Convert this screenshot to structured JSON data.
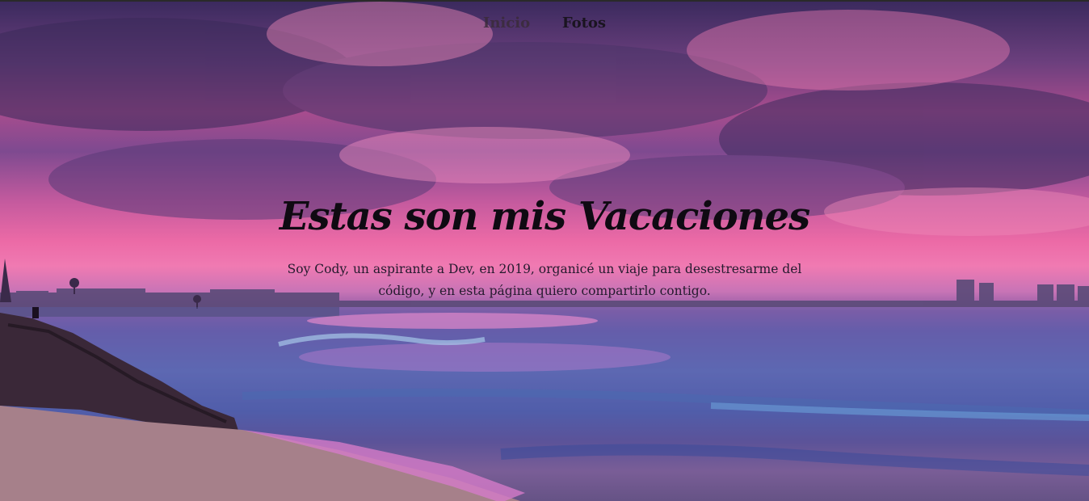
{
  "nav": {
    "items": [
      {
        "label": "Inicio"
      },
      {
        "label": "Fotos"
      }
    ]
  },
  "hero": {
    "title": "Estas son mis Vacaciones",
    "subtitle": "Soy Cody, un aspirante a Dev, en 2019, organicé un viaje para desestresarme del código, y en esta página quiero compartirlo contigo."
  },
  "colors": {
    "sky_purple": "#6b3f7d",
    "sky_pink": "#ec6aa6",
    "sea_blue": "#4b5aa8",
    "text_dark": "#0f0a12"
  }
}
